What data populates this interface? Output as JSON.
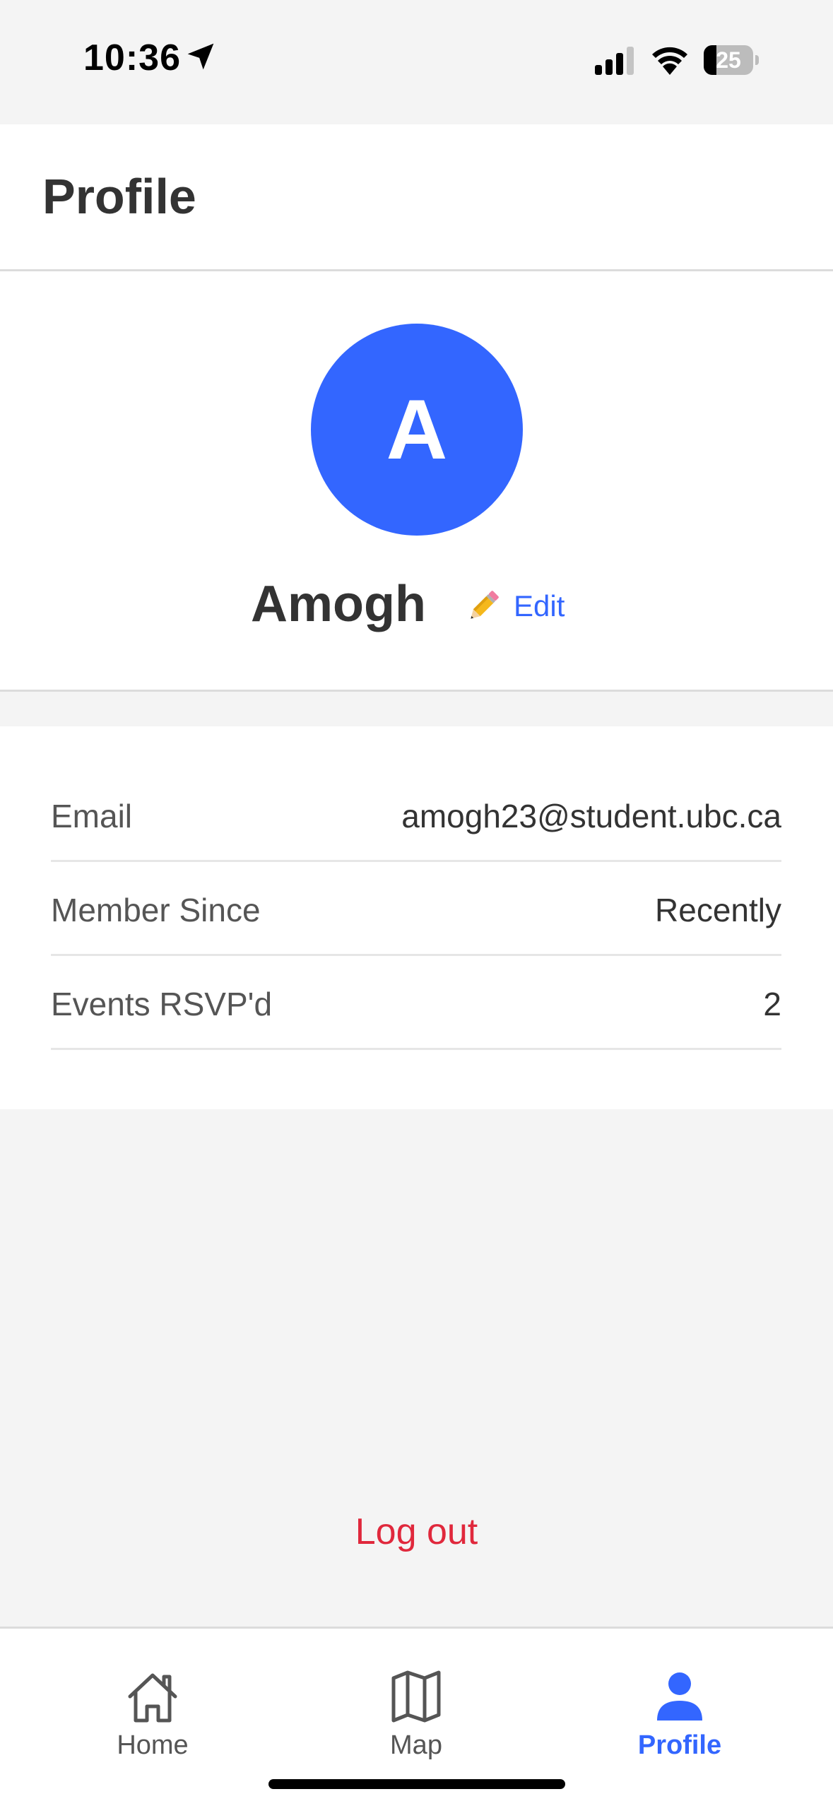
{
  "status_bar": {
    "time": "10:36",
    "battery": "25",
    "battery_level": 0.25
  },
  "header": {
    "title": "Profile"
  },
  "profile": {
    "initial": "A",
    "name": "Amogh",
    "edit_label": "Edit"
  },
  "info": [
    {
      "label": "Email",
      "value": "amogh23@student.ubc.ca"
    },
    {
      "label": "Member Since",
      "value": "Recently"
    },
    {
      "label": "Events RSVP'd",
      "value": "2"
    }
  ],
  "logout_label": "Log out",
  "tabs": [
    {
      "label": "Home",
      "icon": "home-icon",
      "active": false
    },
    {
      "label": "Map",
      "icon": "map-icon",
      "active": false
    },
    {
      "label": "Profile",
      "icon": "person-icon",
      "active": true
    }
  ],
  "colors": {
    "accent": "#3366ff",
    "danger": "#e0283c",
    "background": "#f4f4f4"
  }
}
